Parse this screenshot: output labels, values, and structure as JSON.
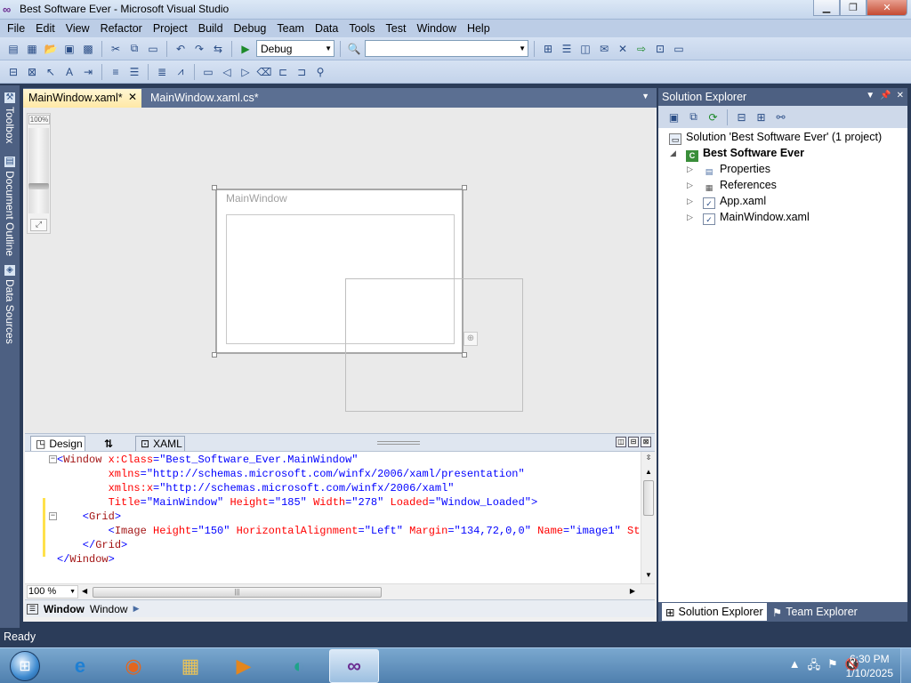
{
  "window": {
    "title": "Best Software Ever - Microsoft Visual Studio"
  },
  "menu": [
    "File",
    "Edit",
    "View",
    "Refactor",
    "Project",
    "Build",
    "Debug",
    "Team",
    "Data",
    "Tools",
    "Test",
    "Window",
    "Help"
  ],
  "toolbar": {
    "config_value": "Debug",
    "platform_value": ""
  },
  "left_tabs": {
    "toolbox": "Toolbox",
    "document_outline": "Document Outline",
    "data_sources": "Data Sources"
  },
  "doc_tabs": {
    "active": "MainWindow.xaml*",
    "inactive": "MainWindow.xaml.cs*"
  },
  "designer": {
    "zoom_label": "100%",
    "window_title": "MainWindow"
  },
  "split": {
    "design_label": "Design",
    "xaml_label": "XAML"
  },
  "code": {
    "lines": [
      {
        "segments": [
          {
            "t": "<",
            "c": "pn"
          },
          {
            "t": "Window",
            "c": "tg"
          },
          {
            "t": " x:Class",
            "c": "at"
          },
          {
            "t": "=\"Best_Software_Ever.MainWindow\"",
            "c": "vl"
          }
        ]
      },
      {
        "segments": [
          {
            "t": "        xmlns",
            "c": "at"
          },
          {
            "t": "=\"http://schemas.microsoft.com/winfx/2006/xaml/presentation\"",
            "c": "vl"
          }
        ]
      },
      {
        "segments": [
          {
            "t": "        xmlns:x",
            "c": "at"
          },
          {
            "t": "=\"http://schemas.microsoft.com/winfx/2006/xaml\"",
            "c": "vl"
          }
        ]
      },
      {
        "segments": [
          {
            "t": "        Title",
            "c": "at"
          },
          {
            "t": "=\"MainWindow\"",
            "c": "vl"
          },
          {
            "t": " Height",
            "c": "at"
          },
          {
            "t": "=\"185\"",
            "c": "vl"
          },
          {
            "t": " Width",
            "c": "at"
          },
          {
            "t": "=\"278\"",
            "c": "vl"
          },
          {
            "t": " Loaded",
            "c": "at"
          },
          {
            "t": "=\"Window_Loaded\"",
            "c": "vl"
          },
          {
            "t": ">",
            "c": "pn"
          }
        ]
      },
      {
        "segments": [
          {
            "t": "    <",
            "c": "pn"
          },
          {
            "t": "Grid",
            "c": "tg"
          },
          {
            "t": ">",
            "c": "pn"
          }
        ]
      },
      {
        "segments": [
          {
            "t": "        <",
            "c": "pn"
          },
          {
            "t": "Image",
            "c": "tg"
          },
          {
            "t": " Height",
            "c": "at"
          },
          {
            "t": "=\"150\"",
            "c": "vl"
          },
          {
            "t": " HorizontalAlignment",
            "c": "at"
          },
          {
            "t": "=\"Left\"",
            "c": "vl"
          },
          {
            "t": " Margin",
            "c": "at"
          },
          {
            "t": "=\"134,72,0,0\"",
            "c": "vl"
          },
          {
            "t": " Name",
            "c": "at"
          },
          {
            "t": "=\"image1\"",
            "c": "vl"
          },
          {
            "t": " Stret",
            "c": "at"
          }
        ]
      },
      {
        "segments": [
          {
            "t": "    </",
            "c": "pn"
          },
          {
            "t": "Grid",
            "c": "tg"
          },
          {
            "t": ">",
            "c": "pn"
          }
        ]
      },
      {
        "segments": [
          {
            "t": "</",
            "c": "pn"
          },
          {
            "t": "Window",
            "c": "tg"
          },
          {
            "t": ">",
            "c": "pn"
          }
        ]
      }
    ]
  },
  "bottom": {
    "zoom_value": "100 %",
    "crumb_bold": "Window",
    "crumb_normal": "Window"
  },
  "solution_explorer": {
    "title": "Solution Explorer",
    "solution": "Solution 'Best Software Ever' (1 project)",
    "project": "Best Software Ever",
    "items": [
      "Properties",
      "References",
      "App.xaml",
      "MainWindow.xaml"
    ],
    "footer_tabs": {
      "solution": "Solution Explorer",
      "team": "Team Explorer"
    }
  },
  "status": {
    "text": "Ready"
  },
  "taskbar": {
    "time": "6:30 PM",
    "date": "1/10/2025"
  }
}
